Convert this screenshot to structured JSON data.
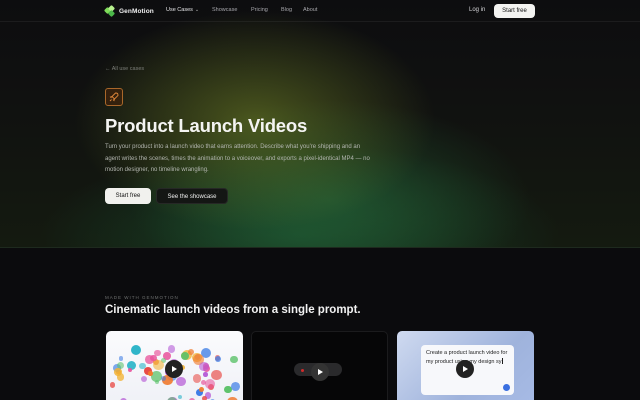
{
  "nav": {
    "brand": "GenMotion",
    "use_cases": "Use Cases",
    "showcase": "Showcase",
    "pricing": "Pricing",
    "blog": "Blog",
    "about": "About",
    "login": "Log in",
    "start_free": "Start free"
  },
  "hero": {
    "back_link": "← All use cases",
    "title": "Product Launch Videos",
    "description": "Turn your product into a launch video that earns attention. Describe what you're shipping and an agent writes the scenes, times the animation to a voiceover, and exports a pixel-identical MP4 — no motion designer, no timeline wrangling.",
    "primary_button": "Start free",
    "secondary_button": "See the showcase"
  },
  "section": {
    "eyebrow": "MADE WITH GENMOTION",
    "title": "Cinematic launch videos from a single prompt."
  },
  "cards": [
    {
      "name": "colorful-dots-video"
    },
    {
      "name": "dark-pill-video"
    },
    {
      "name": "prompt-video",
      "prompt_text": "Create a product launch video for my product using my design sy"
    }
  ],
  "colors": {
    "accent_green": "#7fdc5a",
    "rocket_border": "#a9672a"
  }
}
